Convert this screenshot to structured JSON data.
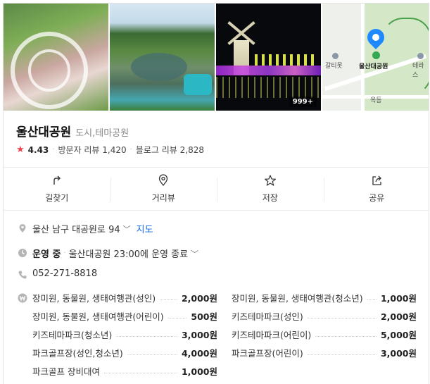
{
  "photos": {
    "more_count": "999+"
  },
  "map": {
    "pin_label": "울산대공원",
    "labels": [
      "갈티못",
      "테라스",
      "옥동"
    ]
  },
  "place": {
    "name": "울산대공원",
    "category": "도시,테마공원",
    "rating": "4.43",
    "visitor_reviews": "방문자 리뷰 1,420",
    "blog_reviews": "블로그 리뷰 2,828"
  },
  "actions": [
    {
      "label": "길찾기",
      "icon": "directions-icon"
    },
    {
      "label": "거리뷰",
      "icon": "street-view-icon"
    },
    {
      "label": "저장",
      "icon": "star-icon"
    },
    {
      "label": "공유",
      "icon": "share-icon"
    }
  ],
  "info": {
    "address": "울산 남구 대공원로 94",
    "map_link": "지도",
    "status": "운영 중",
    "hours": "울산대공원 23:00에 운영 종료",
    "phone": "052-271-8818"
  },
  "prices": [
    {
      "label": "장미원, 동물원, 생태여행관(성인)",
      "value": "2,000원"
    },
    {
      "label": "장미원, 동물원, 생태여행관(청소년)",
      "value": "1,000원"
    },
    {
      "label": "장미원, 동물원, 생태여행관(어린이)",
      "value": "500원"
    },
    {
      "label": "키즈테마파크(성인)",
      "value": "2,000원"
    },
    {
      "label": "키즈테마파크(청소년)",
      "value": "3,000원"
    },
    {
      "label": "키즈테마파크(어린이)",
      "value": "5,000원"
    },
    {
      "label": "파크골프장(성인,청소년)",
      "value": "4,000원"
    },
    {
      "label": "파크골프장(어린이)",
      "value": "3,000원"
    },
    {
      "label": "파크골프 장비대여",
      "value": "1,000원"
    }
  ],
  "colors": {
    "link": "#1668e3",
    "star": "#f0424d",
    "map_pin": "#1e88ff"
  }
}
